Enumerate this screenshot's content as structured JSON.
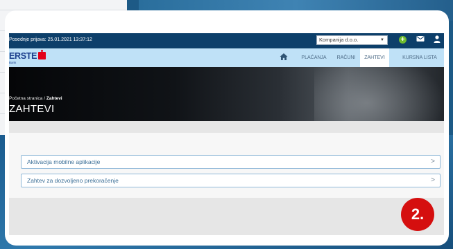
{
  "session": {
    "last_login": "Posednje prijava: 25.01.2021 13:37:12"
  },
  "company_select": {
    "value": "Kompanija d.o.o."
  },
  "icons": {
    "add": "plus-circle-icon",
    "messages": "envelope-icon",
    "profile": "user-icon",
    "home": "home-icon"
  },
  "brand": {
    "name": "ERSTE",
    "sub": "Bank",
    "primary_color": "#1b3e8c",
    "accent_color": "#e2001a"
  },
  "nav": {
    "items": [
      {
        "label": "PLAĆANJA",
        "active": false
      },
      {
        "label": "RAČUNI",
        "active": false
      },
      {
        "label": "ZAHTEVI",
        "active": true
      },
      {
        "label": "KURSNA LISTA",
        "active": false
      }
    ]
  },
  "breadcrumb": {
    "home": "Početna stranica",
    "separator": "/",
    "current": "Zahtevi"
  },
  "page": {
    "title": "ZAHTEVI"
  },
  "requests": {
    "items": [
      {
        "label": "Aktivacija mobilne aplikacije"
      },
      {
        "label": "Zahtev za dozvoljeno prekoračenje"
      }
    ]
  },
  "step_badge": {
    "label": "2.",
    "color": "#d50f0f"
  },
  "colors": {
    "topbar": "#0d3f6a",
    "navbar": "#bfe1f7",
    "item_border": "#8fb8d8",
    "item_text": "#3c6f97"
  }
}
